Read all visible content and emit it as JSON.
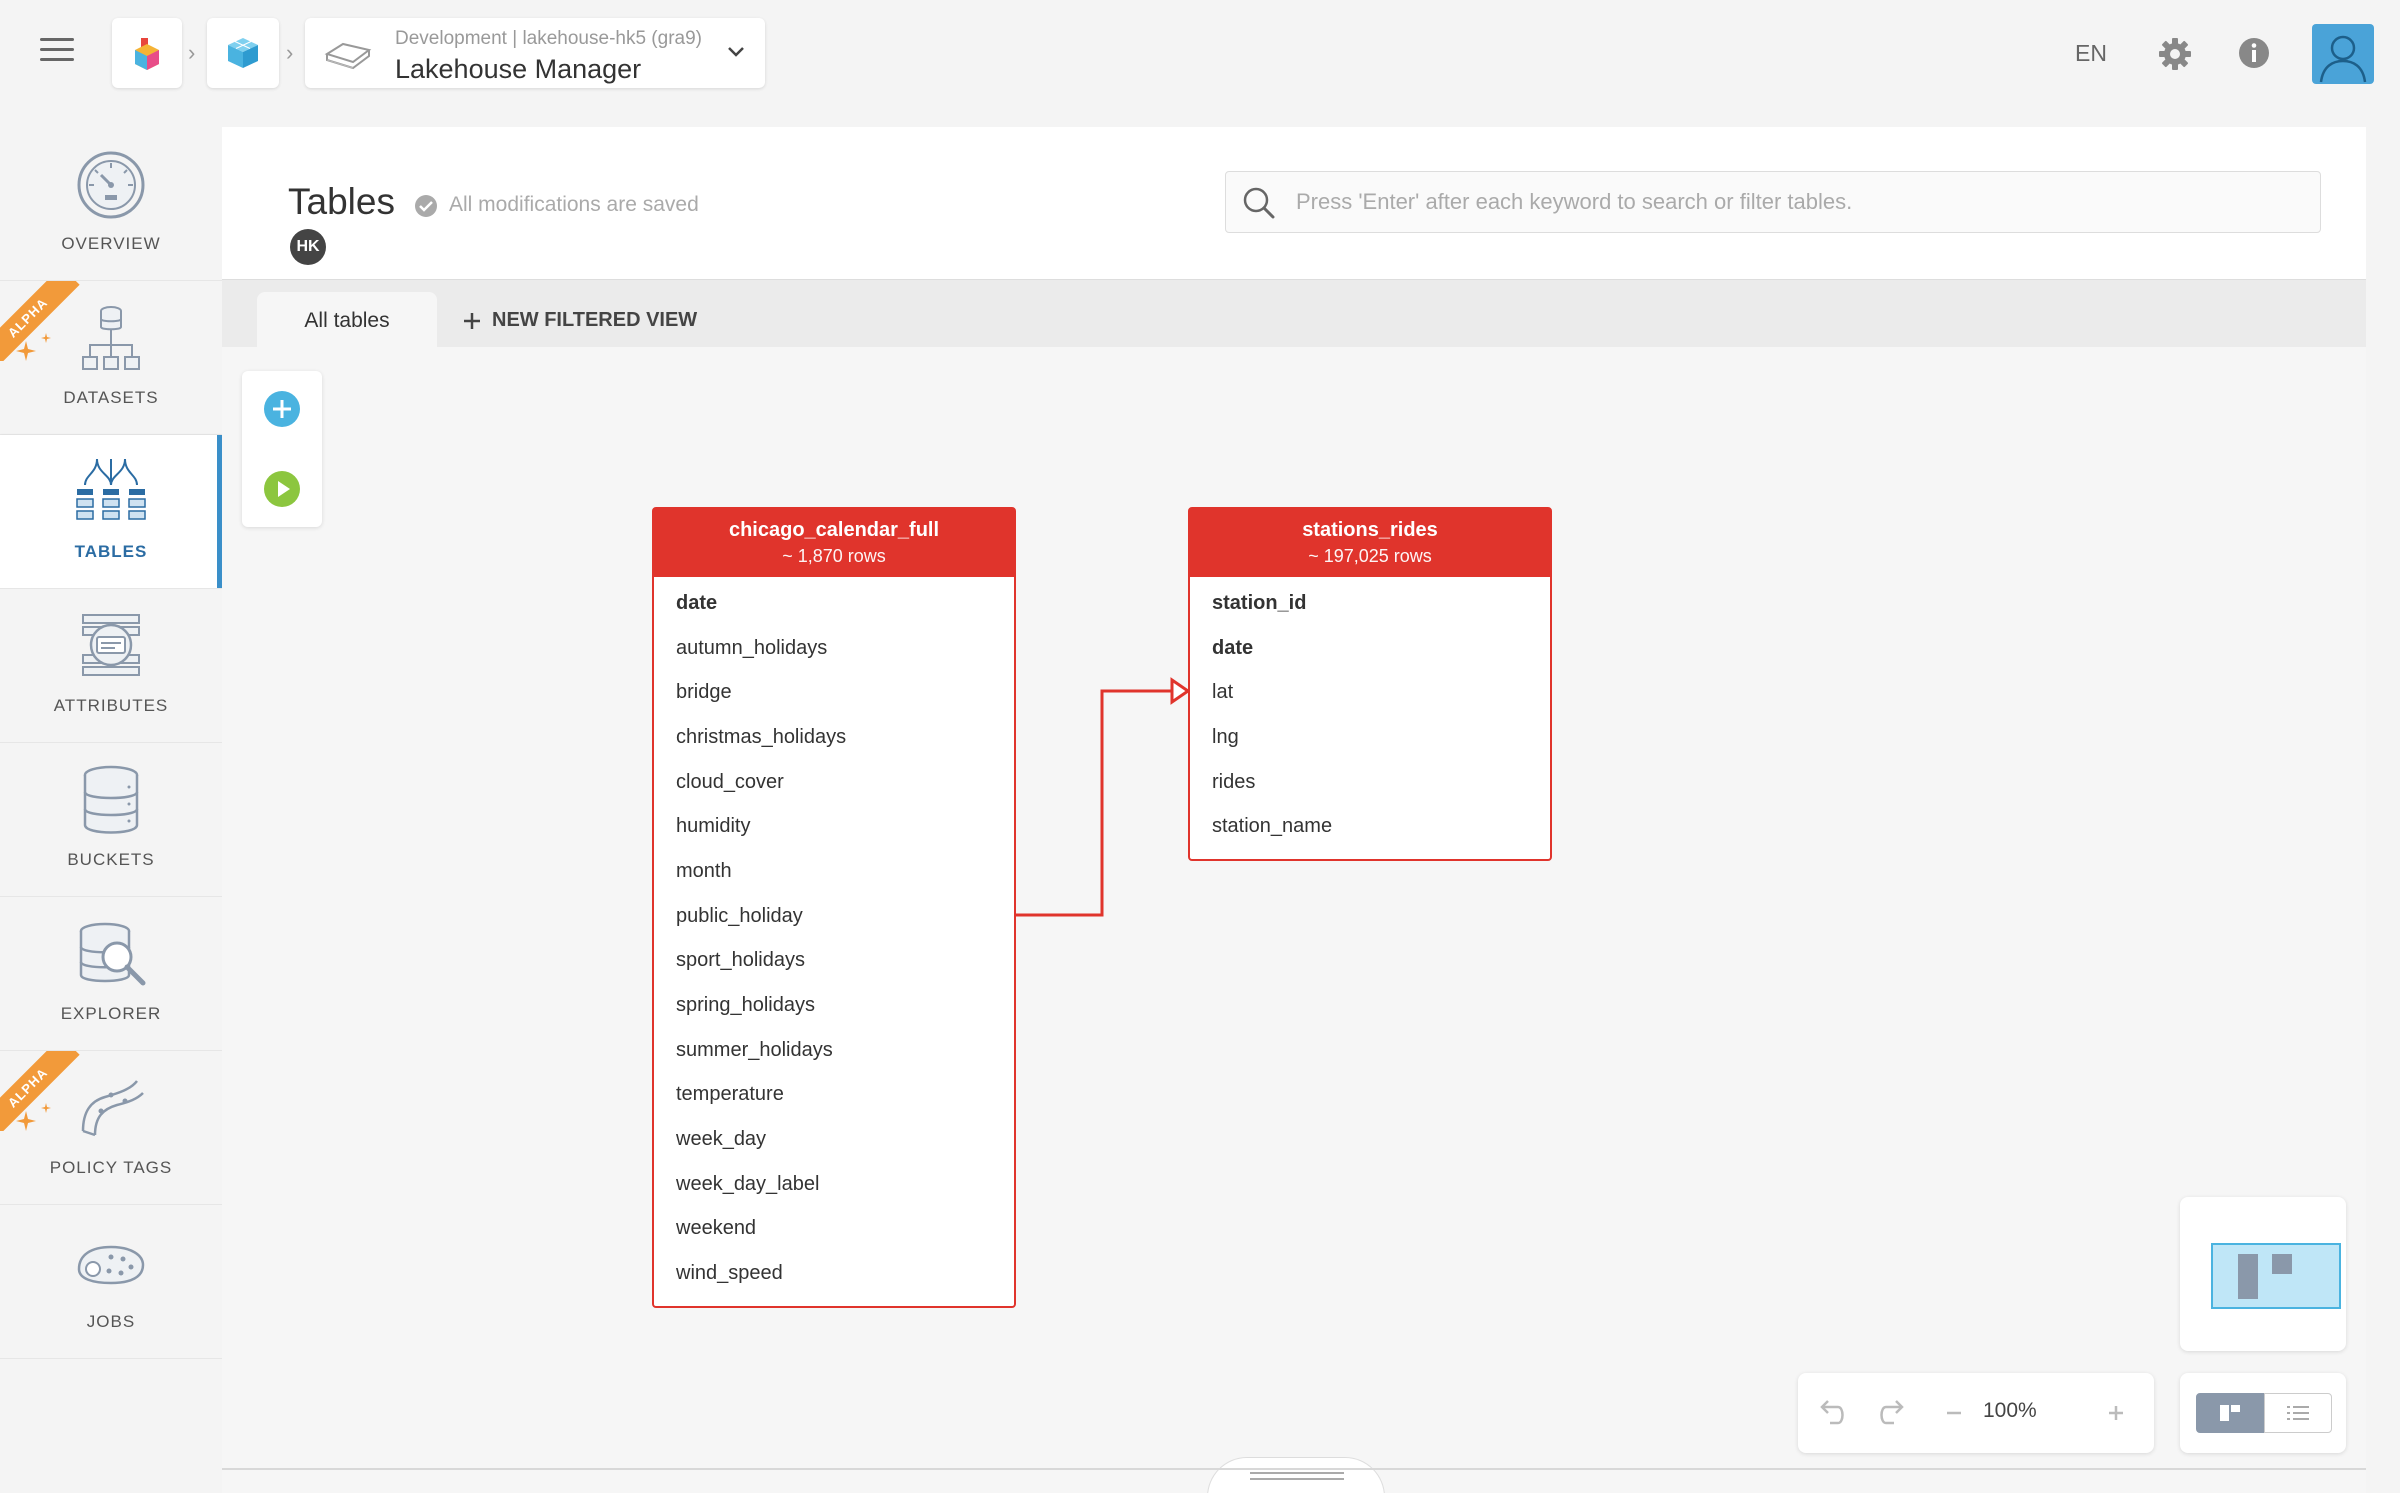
{
  "header": {
    "project_env": "Development | lakehouse-hk5 (gra9)",
    "project_name": "Lakehouse Manager",
    "language": "EN",
    "icons": [
      "menu-icon",
      "app-logo-icon",
      "cube-icon",
      "lakehouse-icon",
      "chevron-down-icon",
      "gear-icon",
      "info-icon",
      "user-avatar-icon"
    ]
  },
  "sidebar": {
    "items": [
      {
        "label": "OVERVIEW",
        "icon": "gauge-icon",
        "alpha": false,
        "active": false
      },
      {
        "label": "DATASETS",
        "icon": "datasets-icon",
        "alpha": true,
        "active": false
      },
      {
        "label": "TABLES",
        "icon": "tables-icon",
        "alpha": false,
        "active": true
      },
      {
        "label": "ATTRIBUTES",
        "icon": "attributes-icon",
        "alpha": false,
        "active": false
      },
      {
        "label": "BUCKETS",
        "icon": "database-icon",
        "alpha": false,
        "active": false
      },
      {
        "label": "EXPLORER",
        "icon": "explorer-icon",
        "alpha": false,
        "active": false
      },
      {
        "label": "POLICY TAGS",
        "icon": "policy-tags-icon",
        "alpha": true,
        "active": false
      },
      {
        "label": "JOBS",
        "icon": "jobs-icon",
        "alpha": false,
        "active": false
      }
    ],
    "alpha_label": "ALPHA"
  },
  "main": {
    "title": "Tables",
    "saved_status": "All modifications are saved",
    "user_initials": "HK",
    "search_placeholder": "Press 'Enter' after each keyword to search or filter tables.",
    "tabs": {
      "all": "All tables",
      "new_view": "NEW FILTERED VIEW"
    }
  },
  "tables": [
    {
      "name": "chicago_calendar_full",
      "rows": "~ 1,870 rows",
      "columns": [
        "date",
        "autumn_holidays",
        "bridge",
        "christmas_holidays",
        "cloud_cover",
        "humidity",
        "month",
        "public_holiday",
        "sport_holidays",
        "spring_holidays",
        "summer_holidays",
        "temperature",
        "week_day",
        "week_day_label",
        "weekend",
        "wind_speed"
      ],
      "key_columns": [
        "date"
      ]
    },
    {
      "name": "stations_rides",
      "rows": "~ 197,025 rows",
      "columns": [
        "station_id",
        "date",
        "lat",
        "lng",
        "rides",
        "station_name"
      ],
      "key_columns": [
        "station_id",
        "date"
      ]
    }
  ],
  "controls": {
    "zoom": "100%"
  },
  "colors": {
    "table_header": "#e0342c",
    "accent_blue": "#3a8fc9",
    "alpha_ribbon": "#f29a3a"
  }
}
